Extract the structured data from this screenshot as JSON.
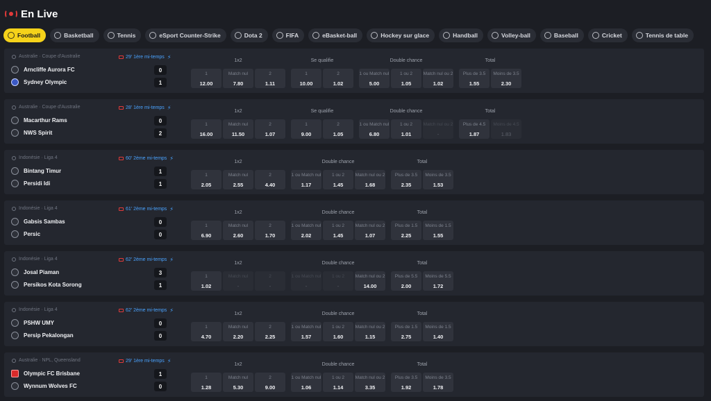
{
  "header": {
    "title": "En Live"
  },
  "sports": [
    {
      "label": "Football",
      "active": true
    },
    {
      "label": "Basketball"
    },
    {
      "label": "Tennis"
    },
    {
      "label": "eSport Counter-Strike"
    },
    {
      "label": "Dota 2"
    },
    {
      "label": "FIFA"
    },
    {
      "label": "eBasket-ball"
    },
    {
      "label": "Hockey sur glace"
    },
    {
      "label": "Handball"
    },
    {
      "label": "Volley-ball"
    },
    {
      "label": "Baseball"
    },
    {
      "label": "Cricket"
    },
    {
      "label": "Tennis de table"
    }
  ],
  "events": [
    {
      "competition": "Australie · Coupe d'Australie",
      "status": "29' 1ère mi-temps",
      "home": {
        "name": "Arncliffe Aurora FC",
        "score": "0",
        "logo": "shield"
      },
      "away": {
        "name": "Sydney Olympic",
        "score": "1",
        "logo": "blue-crest"
      },
      "markets": [
        {
          "title": "1x2",
          "odds": [
            {
              "label": "1",
              "value": "12.00"
            },
            {
              "label": "Match nul",
              "value": "7.80"
            },
            {
              "label": "2",
              "value": "1.11"
            }
          ]
        },
        {
          "title": "Se qualifie",
          "odds": [
            {
              "label": "1",
              "value": "10.00"
            },
            {
              "label": "2",
              "value": "1.02"
            }
          ]
        },
        {
          "title": "Double chance",
          "odds": [
            {
              "label": "1 ou Match nul",
              "value": "5.00"
            },
            {
              "label": "1 ou 2",
              "value": "1.05"
            },
            {
              "label": "Match nul ou 2",
              "value": "1.02"
            }
          ]
        },
        {
          "title": "Total",
          "odds": [
            {
              "label": "Plus de 3.5",
              "value": "1.55"
            },
            {
              "label": "Moins de 3.5",
              "value": "2.30"
            }
          ]
        }
      ]
    },
    {
      "competition": "Australie · Coupe d'Australie",
      "status": "28' 1ère mi-temps",
      "home": {
        "name": "Macarthur Rams",
        "score": "0",
        "logo": "shield"
      },
      "away": {
        "name": "NWS Spirit",
        "score": "2",
        "logo": "shield"
      },
      "markets": [
        {
          "title": "1x2",
          "odds": [
            {
              "label": "1",
              "value": "16.00"
            },
            {
              "label": "Match nul",
              "value": "11.50"
            },
            {
              "label": "2",
              "value": "1.07"
            }
          ]
        },
        {
          "title": "Se qualifie",
          "odds": [
            {
              "label": "1",
              "value": "9.00"
            },
            {
              "label": "2",
              "value": "1.05"
            }
          ]
        },
        {
          "title": "Double chance",
          "odds": [
            {
              "label": "1 ou Match nul",
              "value": "6.80"
            },
            {
              "label": "1 ou 2",
              "value": "1.01"
            },
            {
              "label": "Match nul ou 2",
              "value": "-",
              "disabled": true
            }
          ]
        },
        {
          "title": "Total",
          "odds": [
            {
              "label": "Plus de 4.5",
              "value": "1.87"
            },
            {
              "label": "Moins de 4.5",
              "value": "1.83",
              "disabled": true
            }
          ]
        }
      ]
    },
    {
      "competition": "Indonésie · Liga 4",
      "status": "60' 2ème mi-temps",
      "home": {
        "name": "Bintang Timur",
        "score": "1",
        "logo": "shield"
      },
      "away": {
        "name": "Persidi Idi",
        "score": "1",
        "logo": "shield"
      },
      "markets": [
        {
          "title": "1x2",
          "odds": [
            {
              "label": "1",
              "value": "2.05"
            },
            {
              "label": "Match nul",
              "value": "2.55"
            },
            {
              "label": "2",
              "value": "4.40"
            }
          ]
        },
        {
          "title": "Double chance",
          "odds": [
            {
              "label": "1 ou Match nul",
              "value": "1.17"
            },
            {
              "label": "1 ou 2",
              "value": "1.45"
            },
            {
              "label": "Match nul ou 2",
              "value": "1.68"
            }
          ]
        },
        {
          "title": "Total",
          "odds": [
            {
              "label": "Plus de 3.5",
              "value": "2.35"
            },
            {
              "label": "Moins de 3.5",
              "value": "1.53"
            }
          ]
        }
      ]
    },
    {
      "competition": "Indonésie · Liga 4",
      "status": "61' 2ème mi-temps",
      "home": {
        "name": "Gabsis Sambas",
        "score": "0",
        "logo": "shield"
      },
      "away": {
        "name": "Persic",
        "score": "0",
        "logo": "shield"
      },
      "markets": [
        {
          "title": "1x2",
          "odds": [
            {
              "label": "1",
              "value": "6.90"
            },
            {
              "label": "Match nul",
              "value": "2.60"
            },
            {
              "label": "2",
              "value": "1.70"
            }
          ]
        },
        {
          "title": "Double chance",
          "odds": [
            {
              "label": "1 ou Match nul",
              "value": "2.02"
            },
            {
              "label": "1 ou 2",
              "value": "1.45"
            },
            {
              "label": "Match nul ou 2",
              "value": "1.07"
            }
          ]
        },
        {
          "title": "Total",
          "odds": [
            {
              "label": "Plus de 1.5",
              "value": "2.25"
            },
            {
              "label": "Moins de 1.5",
              "value": "1.55"
            }
          ]
        }
      ]
    },
    {
      "competition": "Indonésie · Liga 4",
      "status": "62' 2ème mi-temps",
      "home": {
        "name": "Josal Piaman",
        "score": "3",
        "logo": "shield"
      },
      "away": {
        "name": "Persikos Kota Sorong",
        "score": "1",
        "logo": "shield"
      },
      "markets": [
        {
          "title": "1x2",
          "odds": [
            {
              "label": "1",
              "value": "1.02"
            },
            {
              "label": "Match nul",
              "value": "-",
              "disabled": true
            },
            {
              "label": "2",
              "value": "-",
              "disabled": true
            }
          ]
        },
        {
          "title": "Double chance",
          "odds": [
            {
              "label": "1 ou Match nul",
              "value": "-",
              "disabled": true
            },
            {
              "label": "1 ou 2",
              "value": "-",
              "disabled": true
            },
            {
              "label": "Match nul ou 2",
              "value": "14.00"
            }
          ]
        },
        {
          "title": "Total",
          "odds": [
            {
              "label": "Plus de 5.5",
              "value": "2.00"
            },
            {
              "label": "Moins de 5.5",
              "value": "1.72"
            }
          ]
        }
      ]
    },
    {
      "competition": "Indonésie · Liga 4",
      "status": "62' 2ème mi-temps",
      "home": {
        "name": "PSHW UMY",
        "score": "0",
        "logo": "shield"
      },
      "away": {
        "name": "Persip Pekalongan",
        "score": "0",
        "logo": "shield"
      },
      "markets": [
        {
          "title": "1x2",
          "odds": [
            {
              "label": "1",
              "value": "4.70"
            },
            {
              "label": "Match nul",
              "value": "2.20"
            },
            {
              "label": "2",
              "value": "2.25"
            }
          ]
        },
        {
          "title": "Double chance",
          "odds": [
            {
              "label": "1 ou Match nul",
              "value": "1.57"
            },
            {
              "label": "1 ou 2",
              "value": "1.60"
            },
            {
              "label": "Match nul ou 2",
              "value": "1.15"
            }
          ]
        },
        {
          "title": "Total",
          "odds": [
            {
              "label": "Plus de 1.5",
              "value": "2.75"
            },
            {
              "label": "Moins de 1.5",
              "value": "1.40"
            }
          ]
        }
      ]
    },
    {
      "competition": "Australie · NPL, Queensland",
      "status": "29' 1ère mi-temps",
      "home": {
        "name": "Olympic FC Brisbane",
        "score": "1",
        "logo": "red-crest"
      },
      "away": {
        "name": "Wynnum Wolves FC",
        "score": "0",
        "logo": "shield"
      },
      "markets": [
        {
          "title": "1x2",
          "odds": [
            {
              "label": "1",
              "value": "1.28"
            },
            {
              "label": "Match nul",
              "value": "5.30"
            },
            {
              "label": "2",
              "value": "9.00"
            }
          ]
        },
        {
          "title": "Double chance",
          "odds": [
            {
              "label": "1 ou Match nul",
              "value": "1.06"
            },
            {
              "label": "1 ou 2",
              "value": "1.14"
            },
            {
              "label": "Match nul ou 2",
              "value": "3.35"
            }
          ]
        },
        {
          "title": "Total",
          "odds": [
            {
              "label": "Plus de 3.5",
              "value": "1.92"
            },
            {
              "label": "Moins de 3.5",
              "value": "1.78"
            }
          ]
        }
      ]
    }
  ],
  "colors": {
    "background": "#1c1e24",
    "card": "#24272f",
    "odd_button": "#30333c",
    "active_tab": "#f5d21a",
    "live_red": "#e23a3a",
    "status_blue": "#4aa3ff"
  }
}
